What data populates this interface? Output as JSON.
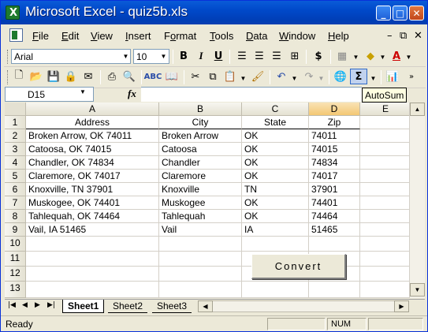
{
  "window": {
    "title": "Microsoft Excel - quiz5b.xls"
  },
  "window_buttons": {
    "minimize": "_",
    "restore": "□",
    "close": "✕"
  },
  "menu": {
    "items": [
      {
        "label": "File",
        "accel": "F",
        "rest": "ile"
      },
      {
        "label": "Edit",
        "accel": "E",
        "rest": "dit"
      },
      {
        "label": "View",
        "accel": "V",
        "rest": "iew"
      },
      {
        "label": "Insert",
        "accel": "I",
        "rest": "nsert"
      },
      {
        "label": "Format",
        "pre": "F",
        "accel": "o",
        "rest": "rmat"
      },
      {
        "label": "Tools",
        "accel": "T",
        "rest": "ools"
      },
      {
        "label": "Data",
        "accel": "D",
        "rest": "ata"
      },
      {
        "label": "Window",
        "accel": "W",
        "rest": "indow"
      },
      {
        "label": "Help",
        "accel": "H",
        "rest": "elp"
      }
    ],
    "mdi_minimize": "–",
    "mdi_restore": "⧉",
    "mdi_close": "✕"
  },
  "formatting": {
    "font": "Arial",
    "size": "10",
    "bold": "B",
    "italic": "I",
    "underline": "U",
    "currency": "$"
  },
  "standard": {
    "autosum": "Σ"
  },
  "formula_bar": {
    "name_box": "D15",
    "fx": "fx",
    "formula": "",
    "tooltip": "AutoSum"
  },
  "grid": {
    "columns": [
      "A",
      "B",
      "C",
      "D",
      "E"
    ],
    "active_column": "D",
    "rows": [
      "1",
      "2",
      "3",
      "4",
      "5",
      "6",
      "7",
      "8",
      "9",
      "10",
      "11",
      "12",
      "13"
    ],
    "headers": {
      "address": "Address",
      "city": "City",
      "state": "State",
      "zip": "Zip"
    },
    "data": [
      {
        "address": "Broken Arrow, OK  74011",
        "city": "Broken Arrow",
        "state": "OK",
        "zip": "74011"
      },
      {
        "address": "Catoosa, OK  74015",
        "city": "Catoosa",
        "state": "OK",
        "zip": "74015"
      },
      {
        "address": "Chandler, OK  74834",
        "city": "Chandler",
        "state": "OK",
        "zip": "74834"
      },
      {
        "address": "Claremore, OK  74017",
        "city": "Claremore",
        "state": "OK",
        "zip": "74017"
      },
      {
        "address": "Knoxville, TN  37901",
        "city": "Knoxville",
        "state": "TN",
        "zip": "37901"
      },
      {
        "address": "Muskogee, OK  74401",
        "city": "Muskogee",
        "state": "OK",
        "zip": "74401"
      },
      {
        "address": "Tahlequah, OK  74464",
        "city": "Tahlequah",
        "state": "OK",
        "zip": "74464"
      },
      {
        "address": "Vail, IA  51465",
        "city": "Vail",
        "state": "IA",
        "zip": "51465"
      }
    ]
  },
  "convert_button": {
    "label": "Convert"
  },
  "sheets": {
    "tabs": [
      "Sheet1",
      "Sheet2",
      "Sheet3"
    ],
    "active": "Sheet1"
  },
  "status": {
    "ready": "Ready",
    "num": "NUM"
  }
}
